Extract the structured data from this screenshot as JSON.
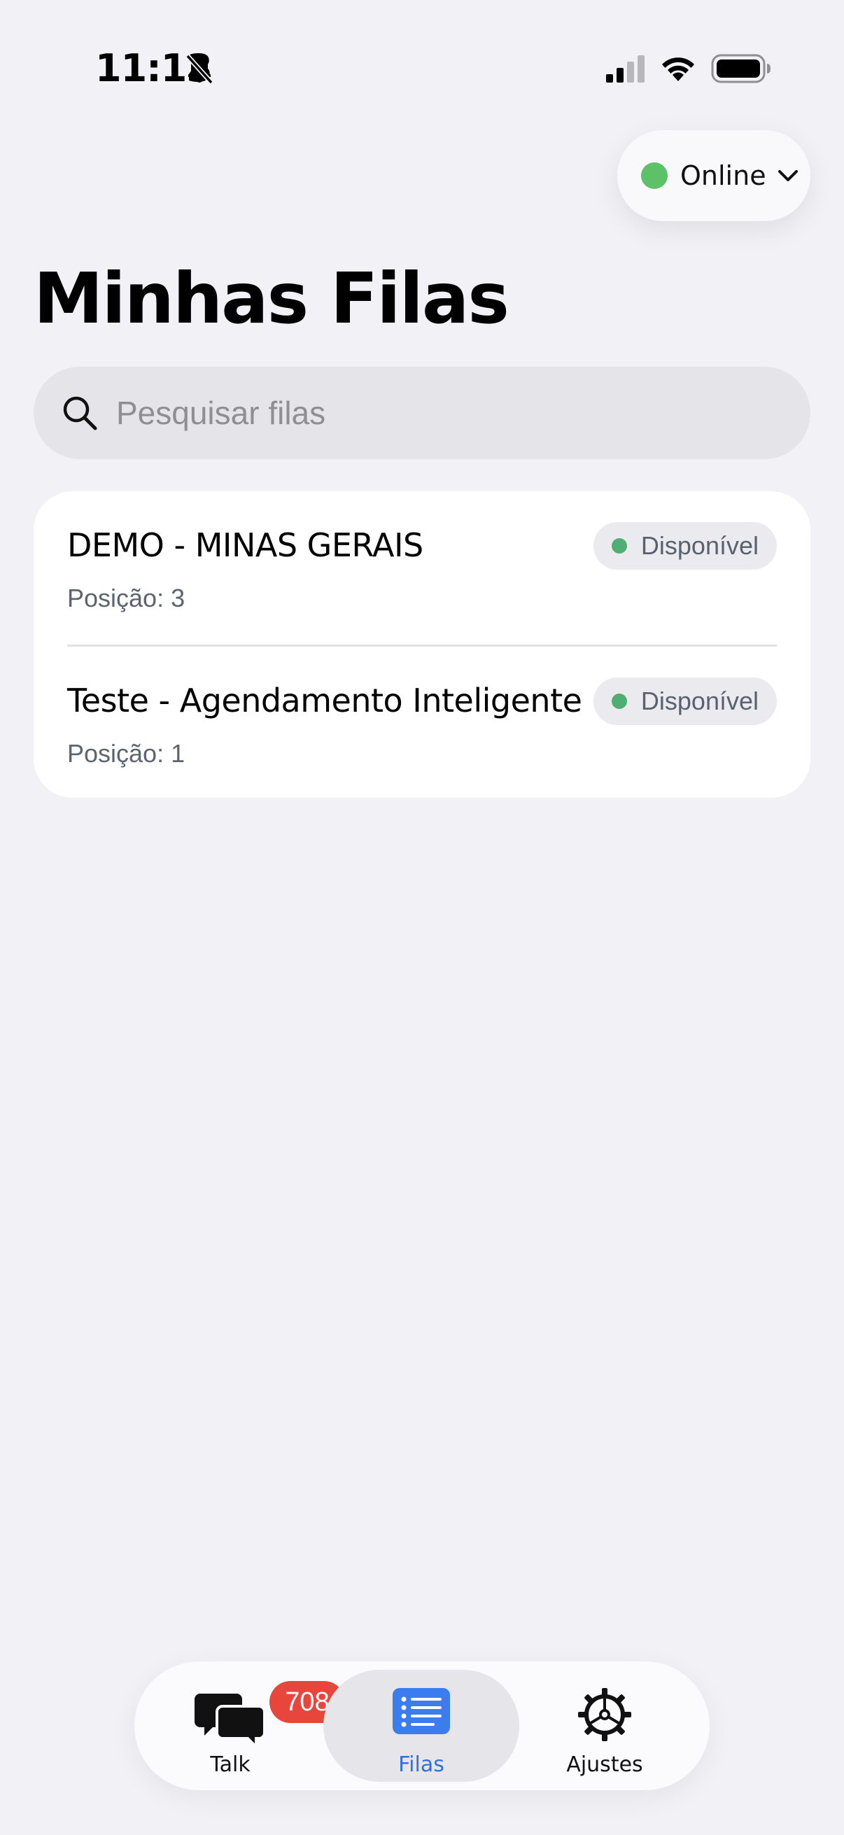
{
  "status_bar": {
    "time": "11:13"
  },
  "presence": {
    "label": "Online",
    "color": "#5cc167"
  },
  "page": {
    "title": "Minhas Filas"
  },
  "search": {
    "placeholder": "Pesquisar filas"
  },
  "queues": [
    {
      "name": "DEMO - MINAS GERAIS",
      "position": "Posição: 3",
      "status": "Disponível"
    },
    {
      "name": "Teste - Agendamento Inteligente",
      "position": "Posição: 1",
      "status": "Disponível"
    }
  ],
  "tab_bar": {
    "items": [
      {
        "label": "Talk",
        "icon": "chat-bubbles-icon",
        "badge": "708"
      },
      {
        "label": "Filas",
        "icon": "list-icon",
        "active": true
      },
      {
        "label": "Ajustes",
        "icon": "gear-icon"
      }
    ]
  },
  "colors": {
    "accent": "#2f6fe0",
    "available": "#4fae72",
    "badge": "#e8453c"
  }
}
